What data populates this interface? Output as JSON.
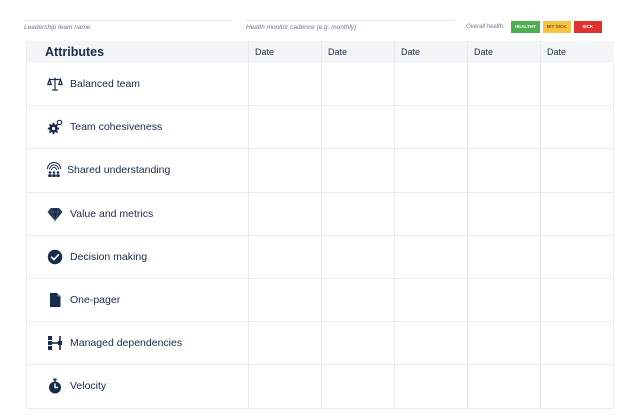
{
  "header": {
    "team_name_placeholder": "Leadership team name",
    "cadence_placeholder": "Health monitor cadence (e.g. monthly)",
    "overall_health_label": "Overall health:",
    "badges": {
      "healthy": "HEALTHY",
      "bit_sick": "BIT SICK",
      "sick": "SICK"
    },
    "colors": {
      "healthy": "#4caf50",
      "bit_sick": "#f6c445",
      "sick": "#e0322f"
    }
  },
  "table": {
    "attributes_header": "Attributes",
    "date_headers": [
      "Date",
      "Date",
      "Date",
      "Date",
      "Date"
    ],
    "rows": [
      {
        "label": "Balanced team",
        "icon": "scales-icon"
      },
      {
        "label": "Team cohesiveness",
        "icon": "gears-icon"
      },
      {
        "label": "Shared understanding",
        "icon": "shared-understanding-icon"
      },
      {
        "label": "Value and metrics",
        "icon": "diamond-icon"
      },
      {
        "label": "Decision making",
        "icon": "checkmark-circle-icon"
      },
      {
        "label": "One-pager",
        "icon": "document-icon"
      },
      {
        "label": "Managed dependencies",
        "icon": "dependencies-icon"
      },
      {
        "label": "Velocity",
        "icon": "stopwatch-icon"
      }
    ]
  }
}
